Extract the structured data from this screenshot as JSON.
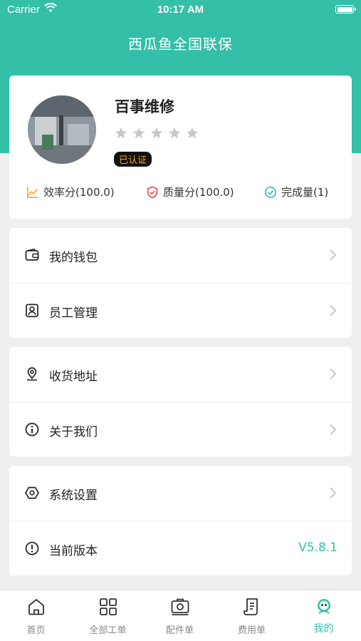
{
  "status_bar": {
    "carrier": "Carrier",
    "time": "10:17 AM"
  },
  "nav": {
    "title": "西瓜鱼全国联保"
  },
  "profile": {
    "name": "百事维修",
    "rating": 0,
    "rating_max": 5,
    "verified_badge": "已认证",
    "stats": [
      {
        "label": "效率分(100.0)",
        "icon": "trend-chart-icon",
        "color": "#f5a623"
      },
      {
        "label": "质量分(100.0)",
        "icon": "shield-icon",
        "color": "#e84a4a"
      },
      {
        "label": "完成量(1)",
        "icon": "check-circle-icon",
        "color": "#33bfa8"
      }
    ]
  },
  "menu": {
    "wallet": "我的钱包",
    "staff": "员工管理",
    "address": "收货地址",
    "about": "关于我们",
    "settings": "系统设置",
    "version_label": "当前版本",
    "version_value": "V5.8.1"
  },
  "tabs": [
    {
      "label": "首页",
      "icon": "home-icon"
    },
    {
      "label": "全部工单",
      "icon": "grid-icon"
    },
    {
      "label": "配件单",
      "icon": "camera-box-icon"
    },
    {
      "label": "费用单",
      "icon": "receipt-icon"
    },
    {
      "label": "我的",
      "icon": "profile-face-icon",
      "active": true
    }
  ],
  "colors": {
    "accent": "#33bfa8",
    "badge_text": "#f5a623"
  }
}
